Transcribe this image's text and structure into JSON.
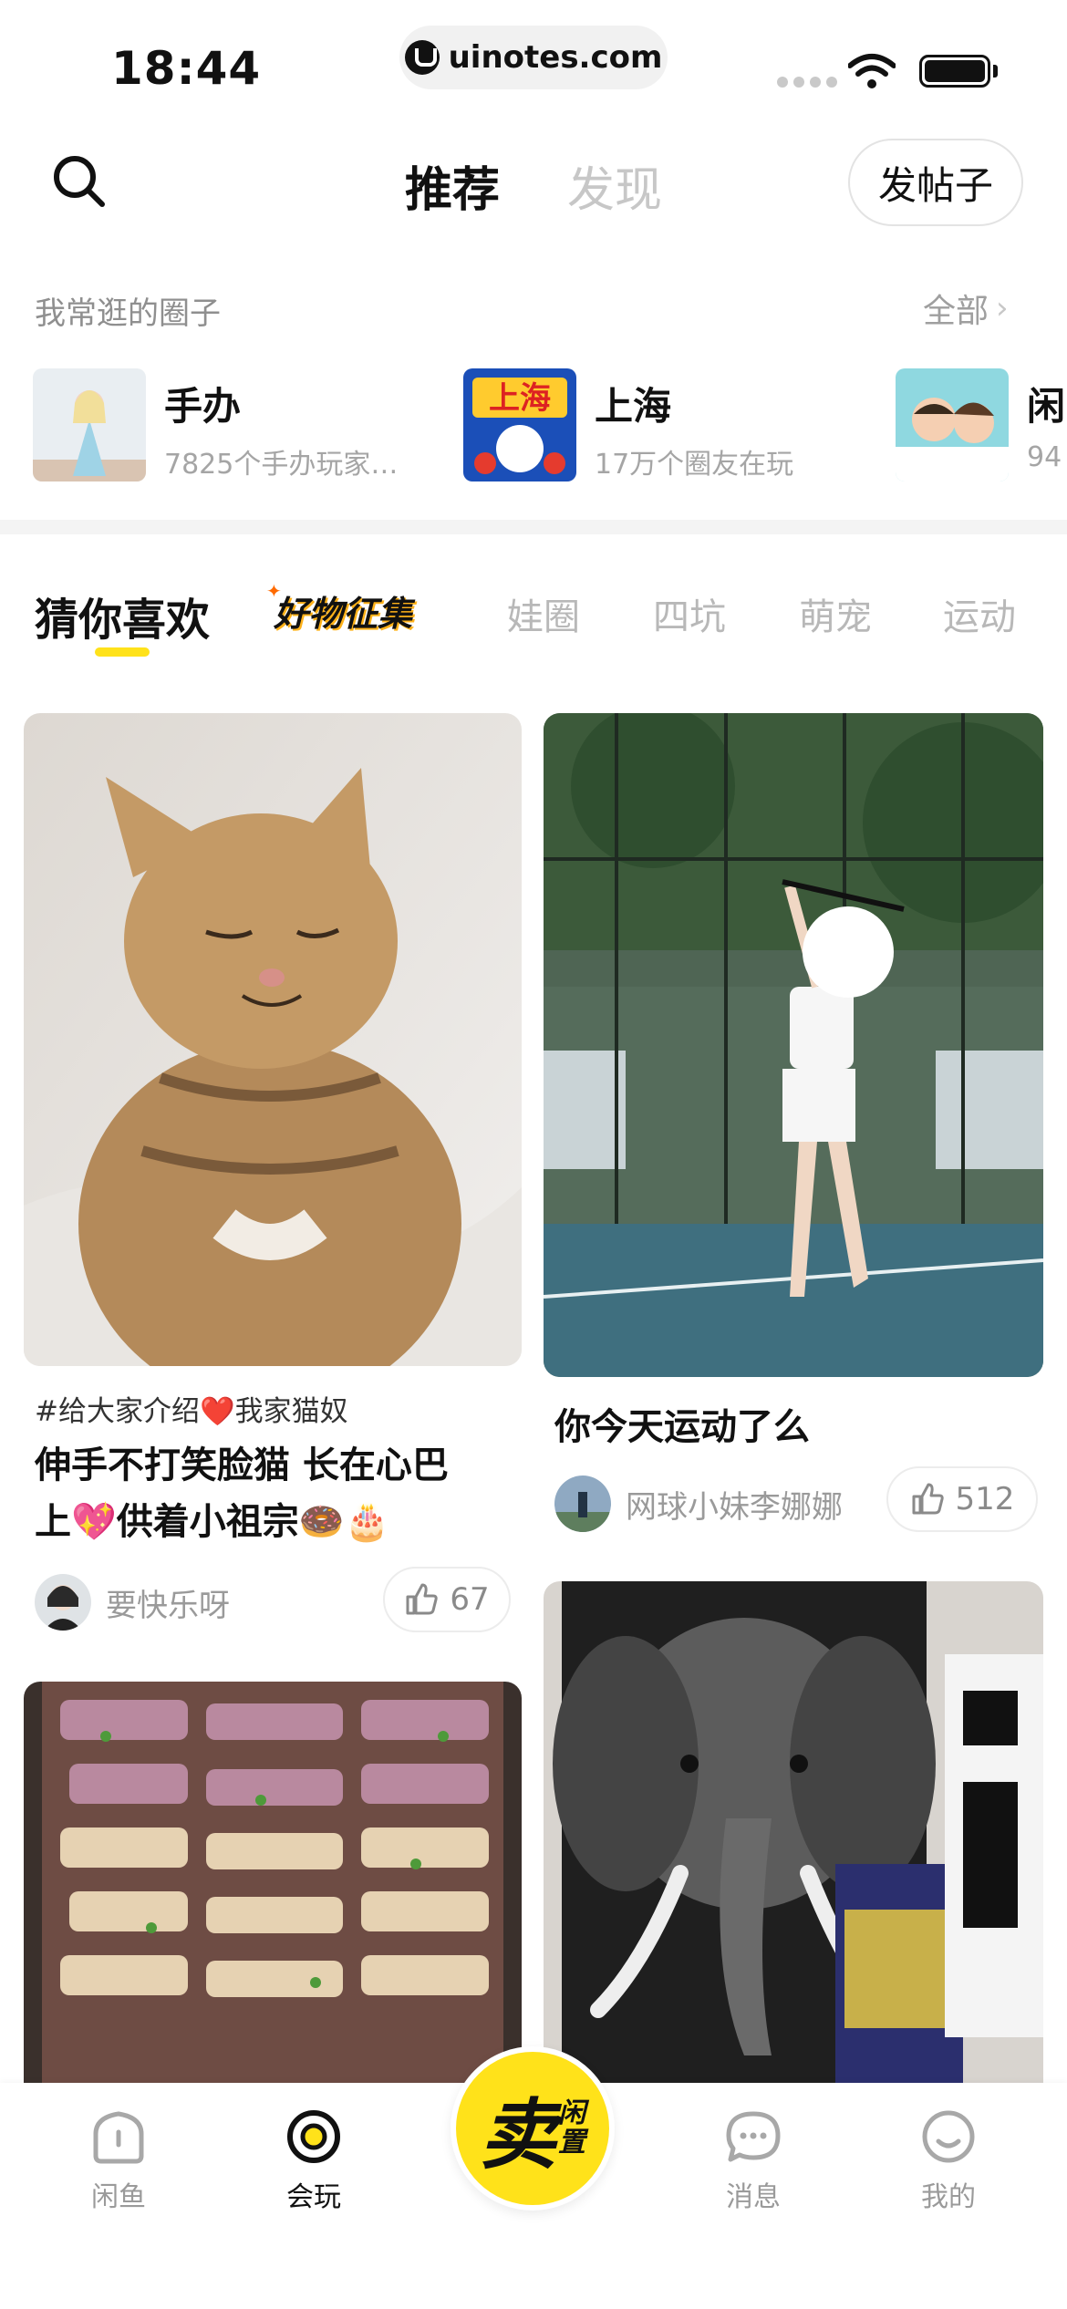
{
  "status_bar": {
    "time": "18:44",
    "url": "uinotes.com"
  },
  "header": {
    "tab_recommend": "推荐",
    "tab_discover": "发现",
    "post_button": "发帖子"
  },
  "circles_section": {
    "title": "我常逛的圈子",
    "all_link": "全部",
    "items": [
      {
        "name": "手办",
        "sub": "7825个手办玩家…"
      },
      {
        "name": "上海",
        "sub": "17万个圈友在玩"
      },
      {
        "name": "闲",
        "sub": "94"
      }
    ]
  },
  "category_tabs": {
    "active": "猜你喜欢",
    "promo": "好物征集",
    "items": [
      "娃圈",
      "四坑",
      "萌宠",
      "运动"
    ]
  },
  "feed": {
    "cards": [
      {
        "tag": "#给大家介绍❤️我家猫奴",
        "title_line1": "伸手不打笑脸猫  长在心巴",
        "title_line2": "上💖供着小祖宗🍩🎂",
        "author": "要快乐呀",
        "likes": "67"
      },
      {
        "tag": "",
        "title_line1": "你今天运动了么",
        "title_line2": "",
        "author": "网球小妹李娜娜",
        "likes": "512"
      }
    ]
  },
  "bottom_nav": {
    "items": [
      {
        "label": "闲鱼",
        "icon": "home-icon"
      },
      {
        "label": "会玩",
        "icon": "target-icon"
      },
      {
        "label": "消息",
        "icon": "message-icon"
      },
      {
        "label": "我的",
        "icon": "face-icon"
      }
    ],
    "sell_main": "卖",
    "sell_side_1": "闲",
    "sell_side_2": "置"
  },
  "colors": {
    "brand_yellow": "#ffe21a",
    "text_muted": "#9a9a9a",
    "divider": "#f4f4f4"
  }
}
